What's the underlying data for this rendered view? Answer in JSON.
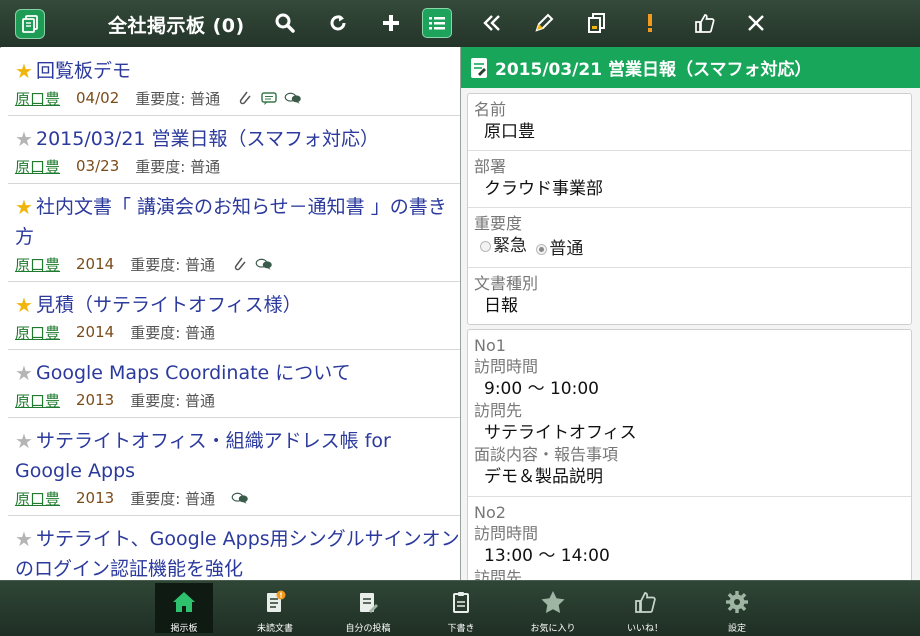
{
  "header": {
    "title": "全社掲示板 (0)",
    "icons": [
      "board-icon",
      "search-icon",
      "refresh-icon",
      "plus-icon",
      "list-menu-icon"
    ]
  },
  "detail_toolbar": {
    "icons": [
      "back-icon",
      "edit-icon",
      "copy-icon",
      "exclamation-icon",
      "like-icon",
      "close-icon"
    ]
  },
  "list": {
    "items": [
      {
        "starred": true,
        "title": "回覧板デモ",
        "author": "原口豊",
        "date": "04/02",
        "importance": "重要度: 普通",
        "icons": [
          "attachment-icon",
          "comment-icon",
          "discussion-icon"
        ]
      },
      {
        "starred": false,
        "title": "2015/03/21 営業日報（スマフォ対応）",
        "author": "原口豊",
        "date": "03/23",
        "importance": "重要度: 普通",
        "icons": []
      },
      {
        "starred": true,
        "title": "社内文書「 講演会のお知らせ－通知書 」の書き方",
        "author": "原口豊",
        "date": "2014",
        "importance": "重要度: 普通",
        "icons": [
          "attachment-icon",
          "discussion-icon"
        ]
      },
      {
        "starred": true,
        "title": "見積（サテライトオフィス様）",
        "author": "原口豊",
        "date": "2014",
        "importance": "重要度: 普通",
        "icons": []
      },
      {
        "starred": false,
        "title": "Google Maps Coordinate について",
        "author": "原口豊",
        "date": "2013",
        "importance": "重要度: 普通",
        "icons": []
      },
      {
        "starred": false,
        "title": "サテライトオフィス・組織アドレス帳 for Google Apps",
        "author": "原口豊",
        "date": "2013",
        "importance": "重要度: 普通",
        "icons": [
          "discussion-icon"
        ]
      },
      {
        "starred": false,
        "title": "サテライト、Google Apps用シングルサインオンのログイン認証機能を強化",
        "author": "",
        "date": "",
        "importance": "",
        "icons": []
      }
    ]
  },
  "detail": {
    "title": "2015/03/21 営業日報（スマフォ対応）",
    "fields": {
      "name_label": "名前",
      "name_value": "原口豊",
      "dept_label": "部署",
      "dept_value": "クラウド事業部",
      "importance_label": "重要度",
      "importance_options": [
        "緊急",
        "普通"
      ],
      "importance_selected": "普通",
      "doctype_label": "文書種別",
      "doctype_value": "日報"
    },
    "visits": [
      {
        "no": "No1",
        "time_label": "訪問時間",
        "time": "9:00 ～ 10:00",
        "dest_label": "訪問先",
        "dest": "サテライトオフィス",
        "content_label": "面談内容・報告事項",
        "content": "デモ＆製品説明"
      },
      {
        "no": "No2",
        "time_label": "訪問時間",
        "time": "13:00 ～ 14:00",
        "dest_label": "訪問先",
        "dest": "",
        "content_label": "",
        "content": ""
      }
    ]
  },
  "tabs": [
    {
      "label": "掲示板",
      "icon": "home-icon",
      "active": true
    },
    {
      "label": "未読文書",
      "icon": "unread-doc-icon",
      "active": false
    },
    {
      "label": "自分の投稿",
      "icon": "my-posts-icon",
      "active": false
    },
    {
      "label": "下書き",
      "icon": "draft-icon",
      "active": false
    },
    {
      "label": "お気に入り",
      "icon": "favorite-star-icon",
      "active": false
    },
    {
      "label": "いいね！",
      "icon": "like-icon",
      "active": false
    },
    {
      "label": "設定",
      "icon": "settings-gear-icon",
      "active": false
    }
  ],
  "colors": {
    "header_dark": "#2b3f31",
    "accent_green": "#18a75a",
    "link_blue": "#2b3a9c",
    "author_green": "#1f7a2e",
    "star_gold": "#f0b60d"
  }
}
